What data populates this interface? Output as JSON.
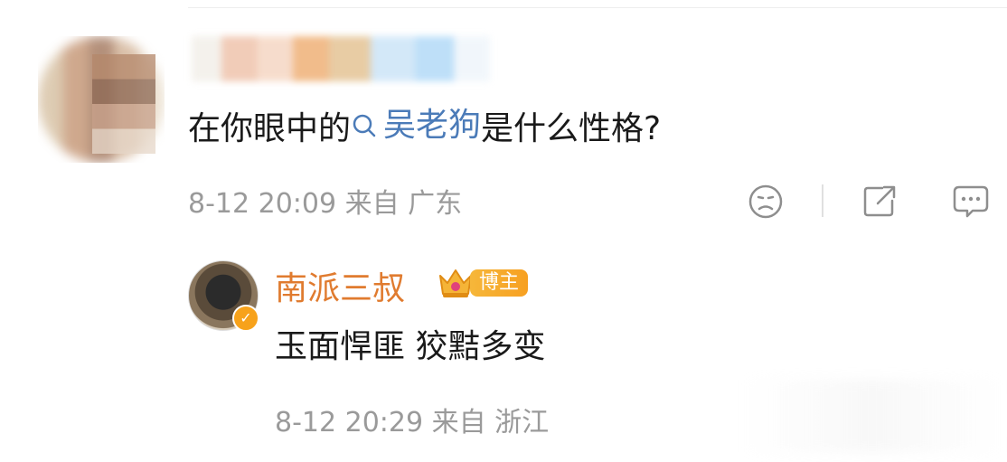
{
  "comment": {
    "text_before": "在你眼中的",
    "link_text": "吴老狗",
    "text_after": "是什么性格?",
    "time": "8-12 20:09",
    "from_label": "来自",
    "location": "广东",
    "actions": [
      {
        "name": "reaction-icon"
      },
      {
        "name": "share-icon"
      },
      {
        "name": "comment-icon"
      }
    ]
  },
  "reply": {
    "username": "南派三叔",
    "badge_label": "博主",
    "text": "玉面悍匪 狡黠多变",
    "time": "8-12 20:29",
    "from_label": "来自",
    "location": "浙江"
  },
  "colors": {
    "link": "#4b7bb8",
    "reply_name": "#e07b2f",
    "badge": "#f7a021",
    "meta": "#9a9a9a"
  }
}
